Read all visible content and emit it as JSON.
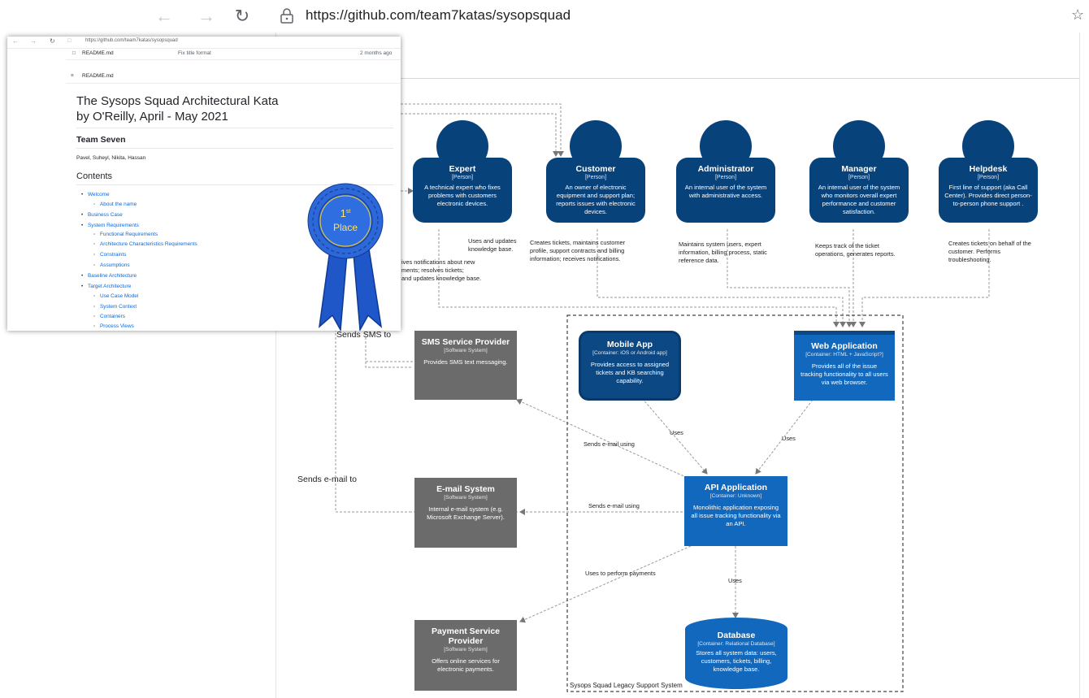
{
  "browser": {
    "url": "https://github.com/team7katas/sysopsquad",
    "url_host_bold": "github.com",
    "back_icon": "arrow-left-icon",
    "forward_icon": "arrow-right-icon",
    "reload_icon": "reload-icon",
    "lock_icon": "lock-icon",
    "favorite_icon": "star-add-icon"
  },
  "diagram": {
    "persons": [
      {
        "name": "Expert",
        "type": "[Person]",
        "desc": "A technical expert who fixes problems with customers electronic devices."
      },
      {
        "name": "Customer",
        "type": "[Person]",
        "desc": "An owner of electronic equipment and support plan; reports issues with electronic devices."
      },
      {
        "name": "Administrator",
        "type": "[Person]",
        "desc": "An internal user of the system with administrative access."
      },
      {
        "name": "Manager",
        "type": "[Person]",
        "desc": "An internal user of the system who monitors overall expert performance and customer satisfaction."
      },
      {
        "name": "Helpdesk",
        "type": "[Person]",
        "desc": "First line of support (aka Call Center). Provides direct person-to-person phone support ."
      }
    ],
    "person_notes": {
      "expert_partial": "ives notifications about new\nments; resolves tickets;\nand updates knowledge base.",
      "expert_kb": "Uses and updates\nknowledge base.",
      "customer": "Creates tickets, maintains customer profile, support contracts and billing information; receives notifications.",
      "administrator": "Maintains system users, expert information, billing process, static reference data.",
      "manager": "Keeps track of the ticket operations, generates reports.",
      "helpdesk": "Creates tickets on behalf of the customer. Performs troubleshooting."
    },
    "systems": {
      "sms": {
        "name": "SMS Service Provider",
        "type": "[Software System]",
        "desc": "Provides SMS text messaging."
      },
      "email": {
        "name": "E-mail System",
        "type": "[Software System]",
        "desc": "Internal e-mail system (e.g. Microsoft Exchange Server)."
      },
      "payment": {
        "name": "Payment Service Provider",
        "type": "[Software System]",
        "desc": "Offers online services for electronic payments."
      }
    },
    "containers": {
      "mobile": {
        "name": "Mobile App",
        "type": "[Container: iOS or Android app]",
        "desc": "Provides access to assigned tickets and KB searching capability."
      },
      "web": {
        "name": "Web Application",
        "type": "[Container: HTML + JavaScript?]",
        "desc": "Provides all of the issue tracking functionality to all users via web browser."
      },
      "api": {
        "name": "API Application",
        "type": "[Container: Unknown]",
        "desc": "Monolithic application exposing all issue tracking functionality via an API."
      },
      "db": {
        "name": "Database",
        "type": "[Container: Relational Database]",
        "desc": "Stores all system data: users, customers, tickets, billing, knowledge base."
      }
    },
    "edges": {
      "sends_sms_to": "Sends SMS to",
      "sends_email_to": "Sends e-mail to",
      "sends_email_using_1": "Sends e-mail using",
      "sends_email_using_2": "Sends e-mail using",
      "uses_mobile": "Uses",
      "uses_web": "Uses",
      "uses_db": "Uses",
      "uses_payments": "Uses to perform payments"
    },
    "boundary_label": "Sysops Squad Legacy Support System",
    "colors": {
      "person": "#08427b",
      "container": "#1168bd",
      "external": "#6b6b6b",
      "mobile": "#0b4884"
    }
  },
  "inset": {
    "url": "https://github.com/team7katas/sysopsquad",
    "file_row": {
      "name": "README.md",
      "commit": "Fix title format",
      "age": "2 months ago"
    },
    "readme_label": "README.md",
    "title_line1": "The Sysops Squad Architectural Kata",
    "title_line2": "by O'Reilly, April - May 2021",
    "team_heading": "Team Seven",
    "team_members": "Pavel, Suheyl, Nikita, Hassan",
    "contents_heading": "Contents",
    "toc": [
      "Welcome",
      "About the name",
      "Business Case",
      "System Requirements",
      "Functional Requirements",
      "Architecture Characteristics Requirements",
      "Constraints",
      "Assumptions",
      "Baseline Architecture",
      "Target Architecture",
      "Use Case Model",
      "System Context",
      "Containers",
      "Process Views"
    ],
    "ribbon": {
      "rank": "1",
      "suffix": "st",
      "word": "Place",
      "icon": "award-ribbon-icon"
    }
  }
}
